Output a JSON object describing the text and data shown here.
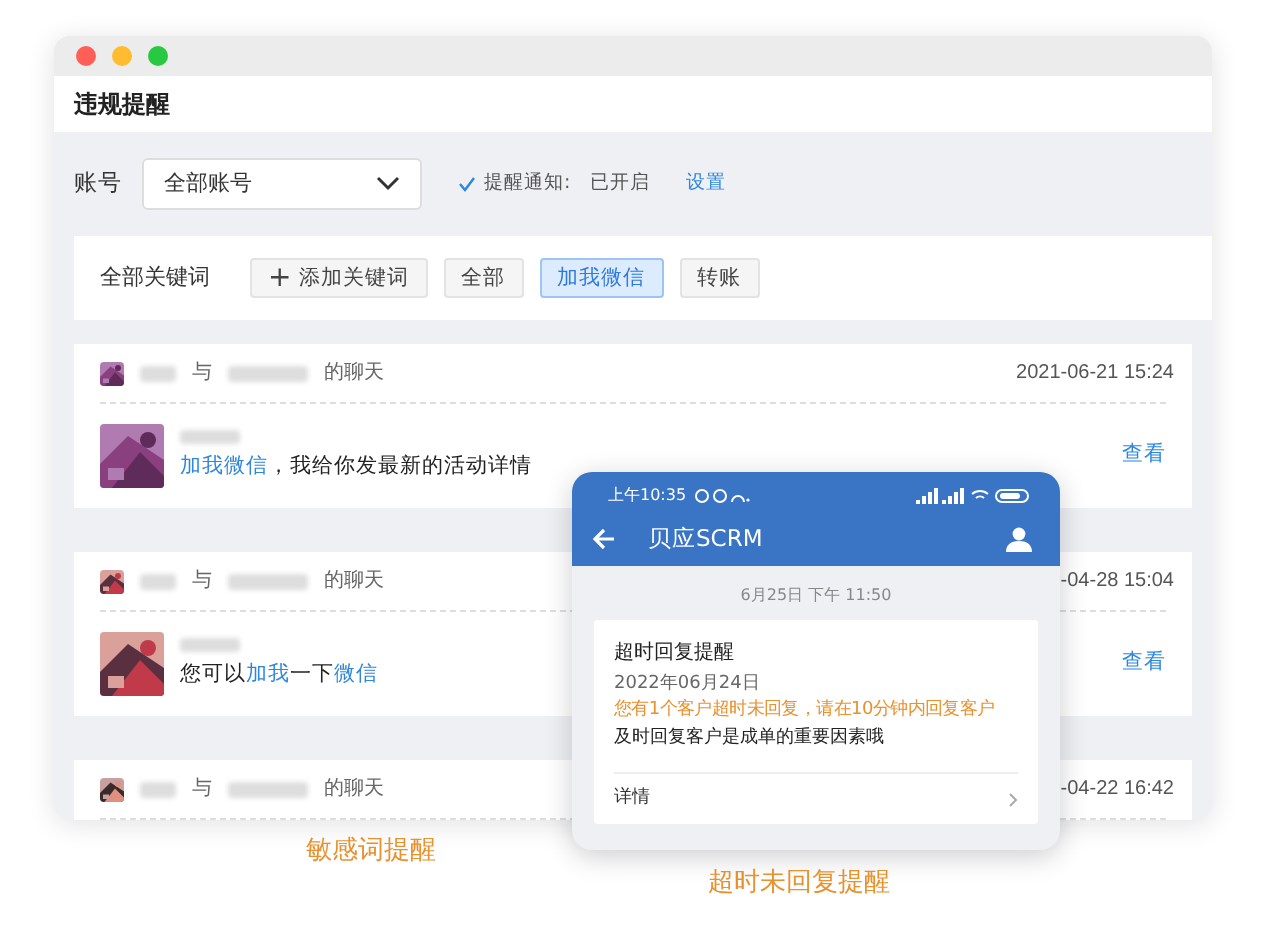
{
  "window": {
    "title": "违规提醒"
  },
  "filter": {
    "label": "账号",
    "select_value": "全部账号",
    "notice_label": "提醒通知:",
    "notice_state": "已开启",
    "notice_enabled": true,
    "settings_link": "设置"
  },
  "keywords": {
    "label": "全部关键词",
    "add_button": "添加关键词",
    "add_icon": "+",
    "chips": [
      {
        "label": "全部",
        "selected": false
      },
      {
        "label": "加我微信",
        "selected": true
      },
      {
        "label": "转账",
        "selected": false
      }
    ]
  },
  "chats": [
    {
      "connector": "与",
      "suffix": "的聊天",
      "time": "2021-06-21 15:24",
      "message": [
        {
          "kind": "link",
          "text": "加我微信"
        },
        {
          "kind": "text",
          "text": "，我给你发最新的活动详情"
        }
      ],
      "action": "查看"
    },
    {
      "connector": "与",
      "suffix": "的聊天",
      "time": "-04-28 15:04",
      "message": [
        {
          "kind": "text",
          "text": "您可以"
        },
        {
          "kind": "link",
          "text": "加我"
        },
        {
          "kind": "text",
          "text": "一下"
        },
        {
          "kind": "link",
          "text": "微信"
        }
      ],
      "action": "查看"
    },
    {
      "connector": "与",
      "suffix": "的聊天",
      "time": "-04-22 16:42"
    }
  ],
  "phone": {
    "status_time": "上午10:35",
    "app_title": "贝应SCRM",
    "timestamp": "6月25日 下午 11:50",
    "card": {
      "title": "超时回复提醒",
      "date": "2022年06月24日",
      "alert": "您有1个客户超时未回复，请在10分钟内回复客户",
      "note": "及时回复客户是成单的重要因素哦",
      "details": "详情"
    }
  },
  "captions": [
    "敏感词提醒",
    "超时未回复提醒"
  ]
}
